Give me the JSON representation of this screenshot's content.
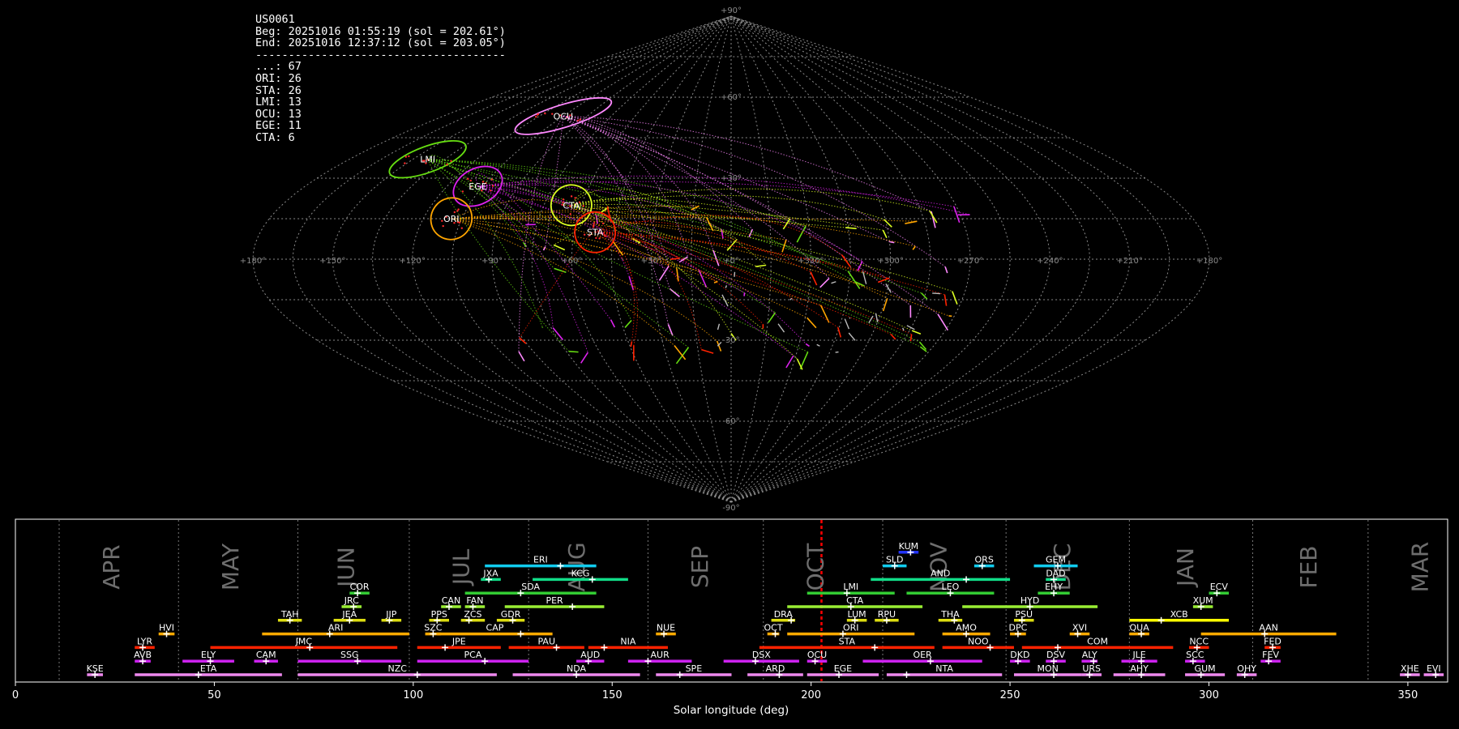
{
  "info": {
    "camera": "US0061",
    "beg": "Beg: 20251016 01:55:19 (sol = 202.61°)",
    "end": "End: 20251016 12:37:12 (sol = 203.05°)",
    "rule": "--------------------------------------",
    "counts": [
      "...: 67",
      "ORI: 26",
      "STA: 26",
      "LMI: 13",
      "OCU: 13",
      "EGE: 11",
      "CTA: 6"
    ]
  },
  "colors": {
    "ORI": "#ffa500",
    "STA": "#ff2200",
    "LMI": "#66dd11",
    "OCU": "#ff88ff",
    "EGE": "#dd22ee",
    "CTA": "#ddff22",
    "sporadic": "#bbbbbb"
  },
  "chart_data": [
    {
      "type": "scatter",
      "projection": "sinusoidal",
      "x_ticks": [
        "+180°",
        "+150°",
        "+120°",
        "+90°",
        "+60°",
        "+30°",
        "+0°",
        "+330°",
        "+300°",
        "+270°",
        "+240°",
        "+210°",
        "+180°"
      ],
      "y_ticks": [
        "+90°",
        "+60°",
        "+30°",
        "+0°",
        "-30°",
        "-60°",
        "-90°"
      ],
      "radiants": [
        {
          "name": "OCU",
          "lon": 105,
          "lat": 53,
          "color": "#ff88ff"
        },
        {
          "name": "LMI",
          "lon": 143,
          "lat": 37,
          "color": "#66dd11"
        },
        {
          "name": "EGE",
          "lon": 107,
          "lat": 27,
          "color": "#dd22ee"
        },
        {
          "name": "ORI",
          "lon": 109,
          "lat": 15,
          "color": "#ffa500"
        },
        {
          "name": "CTA",
          "lon": 64,
          "lat": 20,
          "color": "#ddff22"
        },
        {
          "name": "STA",
          "lon": 52,
          "lat": 10,
          "color": "#ff2200"
        }
      ]
    },
    {
      "type": "bar",
      "orientation": "horizontal",
      "xlabel": "Solar longitude (deg)",
      "xlim": [
        0,
        360
      ],
      "x_ticks": [
        0,
        50,
        100,
        150,
        200,
        250,
        300,
        350
      ],
      "months": [
        {
          "label": "APR",
          "sol": 24
        },
        {
          "label": "MAY",
          "sol": 54
        },
        {
          "label": "JUN",
          "sol": 83
        },
        {
          "label": "JUL",
          "sol": 112
        },
        {
          "label": "AUG",
          "sol": 141
        },
        {
          "label": "SEP",
          "sol": 172
        },
        {
          "label": "OCT",
          "sol": 201
        },
        {
          "label": "NOV",
          "sol": 232
        },
        {
          "label": "DEC",
          "sol": 263
        },
        {
          "label": "JAN",
          "sol": 294
        },
        {
          "label": "FEB",
          "sol": 325
        },
        {
          "label": "MAR",
          "sol": 353
        }
      ],
      "month_boundaries": [
        11,
        41,
        71,
        99,
        129,
        159,
        188,
        218,
        249,
        280,
        311,
        340
      ],
      "current_sol": 202.61,
      "showers": [
        {
          "code": "KUM",
          "start": 222,
          "end": 227,
          "peak": 225,
          "row": 11,
          "color": "#2233ff"
        },
        {
          "code": "ERI",
          "start": 118,
          "end": 146,
          "peak": 137,
          "row": 10,
          "color": "#11ccee"
        },
        {
          "code": "SLD",
          "start": 218,
          "end": 224,
          "peak": 221,
          "row": 10,
          "color": "#11ccee"
        },
        {
          "code": "ORS",
          "start": 241,
          "end": 246,
          "peak": 243,
          "row": 10,
          "color": "#11ccee"
        },
        {
          "code": "GEM",
          "start": 256,
          "end": 267,
          "peak": 262,
          "row": 10,
          "color": "#11ccee"
        },
        {
          "code": "JXA",
          "start": 117,
          "end": 122,
          "peak": 119,
          "row": 9,
          "color": "#11dd88"
        },
        {
          "code": "KCG",
          "start": 130,
          "end": 154,
          "peak": 145,
          "row": 9,
          "color": "#11dd88"
        },
        {
          "code": "AND",
          "start": 215,
          "end": 250,
          "peak": 239,
          "row": 9,
          "color": "#11dd88"
        },
        {
          "code": "DAD",
          "start": 259,
          "end": 264,
          "peak": 261,
          "row": 9,
          "color": "#11dd88"
        },
        {
          "code": "COR",
          "start": 84,
          "end": 89,
          "peak": 86,
          "row": 8,
          "color": "#33cc33"
        },
        {
          "code": "SDA",
          "start": 113,
          "end": 146,
          "peak": 127,
          "row": 8,
          "color": "#33cc33"
        },
        {
          "code": "LMI",
          "start": 199,
          "end": 221,
          "peak": 209,
          "row": 8,
          "color": "#33cc33"
        },
        {
          "code": "LEO",
          "start": 224,
          "end": 246,
          "peak": 235,
          "row": 8,
          "color": "#33cc33"
        },
        {
          "code": "EHY",
          "start": 257,
          "end": 265,
          "peak": 261,
          "row": 8,
          "color": "#33cc33"
        },
        {
          "code": "ECV",
          "start": 300,
          "end": 305,
          "peak": 302,
          "row": 8,
          "color": "#33cc33"
        },
        {
          "code": "JRC",
          "start": 82,
          "end": 87,
          "peak": 85,
          "row": 7,
          "color": "#99ee33"
        },
        {
          "code": "CAN",
          "start": 107,
          "end": 112,
          "peak": 109,
          "row": 7,
          "color": "#99ee33"
        },
        {
          "code": "FAN",
          "start": 113,
          "end": 118,
          "peak": 115,
          "row": 7,
          "color": "#99ee33"
        },
        {
          "code": "PER",
          "start": 123,
          "end": 148,
          "peak": 140,
          "row": 7,
          "color": "#99ee33"
        },
        {
          "code": "CTA",
          "start": 194,
          "end": 228,
          "peak": 210,
          "row": 7,
          "color": "#99ee33"
        },
        {
          "code": "HYD",
          "start": 238,
          "end": 272,
          "peak": 255,
          "row": 7,
          "color": "#99ee33"
        },
        {
          "code": "XUM",
          "start": 296,
          "end": 301,
          "peak": 298,
          "row": 7,
          "color": "#99ee33"
        },
        {
          "code": "TAH",
          "start": 66,
          "end": 72,
          "peak": 69,
          "row": 6,
          "color": "#dddd11"
        },
        {
          "code": "JEA",
          "start": 80,
          "end": 88,
          "peak": 84,
          "row": 6,
          "color": "#dddd11"
        },
        {
          "code": "JIP",
          "start": 92,
          "end": 97,
          "peak": 94,
          "row": 6,
          "color": "#dddd11"
        },
        {
          "code": "PPS",
          "start": 104,
          "end": 109,
          "peak": 106,
          "row": 6,
          "color": "#dddd11"
        },
        {
          "code": "ZCS",
          "start": 112,
          "end": 118,
          "peak": 114,
          "row": 6,
          "color": "#dddd11"
        },
        {
          "code": "GDR",
          "start": 121,
          "end": 128,
          "peak": 125,
          "row": 6,
          "color": "#dddd11"
        },
        {
          "code": "DRA",
          "start": 190,
          "end": 196,
          "peak": 195,
          "row": 6,
          "color": "#dddd11"
        },
        {
          "code": "LUM",
          "start": 209,
          "end": 214,
          "peak": 211,
          "row": 6,
          "color": "#dddd11"
        },
        {
          "code": "RPU",
          "start": 216,
          "end": 222,
          "peak": 219,
          "row": 6,
          "color": "#dddd11"
        },
        {
          "code": "THA",
          "start": 232,
          "end": 238,
          "peak": 236,
          "row": 6,
          "color": "#dddd11"
        },
        {
          "code": "PSU",
          "start": 251,
          "end": 256,
          "peak": 253,
          "row": 6,
          "color": "#dddd11"
        },
        {
          "code": "XCB",
          "start": 280,
          "end": 305,
          "peak": 288,
          "row": 6,
          "color": "#ffff00"
        },
        {
          "code": "HVI",
          "start": 36,
          "end": 40,
          "peak": 38,
          "row": 5,
          "color": "#ffaa00"
        },
        {
          "code": "ARI",
          "start": 62,
          "end": 99,
          "peak": 79,
          "row": 5,
          "color": "#ffaa00"
        },
        {
          "code": "SZC",
          "start": 103,
          "end": 107,
          "peak": 105,
          "row": 5,
          "color": "#ffaa00"
        },
        {
          "code": "CAP",
          "start": 106,
          "end": 135,
          "peak": 127,
          "row": 5,
          "color": "#ffaa00"
        },
        {
          "code": "NUE",
          "start": 161,
          "end": 166,
          "peak": 163,
          "row": 5,
          "color": "#ffaa00"
        },
        {
          "code": "OCT",
          "start": 189,
          "end": 192,
          "peak": 191,
          "row": 5,
          "color": "#ffaa00"
        },
        {
          "code": "ORI",
          "start": 194,
          "end": 226,
          "peak": 208,
          "row": 5,
          "color": "#ffaa00"
        },
        {
          "code": "AMO",
          "start": 233,
          "end": 245,
          "peak": 239,
          "row": 5,
          "color": "#ffaa00"
        },
        {
          "code": "DPC",
          "start": 250,
          "end": 254,
          "peak": 252,
          "row": 5,
          "color": "#ffaa00"
        },
        {
          "code": "XVI",
          "start": 265,
          "end": 270,
          "peak": 267,
          "row": 5,
          "color": "#ffaa00"
        },
        {
          "code": "QUA",
          "start": 280,
          "end": 285,
          "peak": 283,
          "row": 5,
          "color": "#ffaa00"
        },
        {
          "code": "AAN",
          "start": 298,
          "end": 332,
          "peak": 314,
          "row": 5,
          "color": "#ffaa00"
        },
        {
          "code": "LYR",
          "start": 30,
          "end": 35,
          "peak": 32,
          "row": 4,
          "color": "#ff2200"
        },
        {
          "code": "JMC",
          "start": 49,
          "end": 96,
          "peak": 74,
          "row": 4,
          "color": "#ff2200"
        },
        {
          "code": "JPE",
          "start": 101,
          "end": 122,
          "peak": 108,
          "row": 4,
          "color": "#ff2200"
        },
        {
          "code": "PAU",
          "start": 124,
          "end": 143,
          "peak": 136,
          "row": 4,
          "color": "#ff2200"
        },
        {
          "code": "NIA",
          "start": 144,
          "end": 164,
          "peak": 148,
          "row": 4,
          "color": "#ff2200"
        },
        {
          "code": "STA",
          "start": 187,
          "end": 231,
          "peak": 216,
          "row": 4,
          "color": "#ff2200"
        },
        {
          "code": "NOO",
          "start": 233,
          "end": 251,
          "peak": 245,
          "row": 4,
          "color": "#ff2200"
        },
        {
          "code": "COM",
          "start": 253,
          "end": 291,
          "peak": 262,
          "row": 4,
          "color": "#ff2200"
        },
        {
          "code": "NCC",
          "start": 295,
          "end": 300,
          "peak": 297,
          "row": 4,
          "color": "#ff2200"
        },
        {
          "code": "FED",
          "start": 314,
          "end": 318,
          "peak": 316,
          "row": 4,
          "color": "#ff2200"
        },
        {
          "code": "AVB",
          "start": 30,
          "end": 34,
          "peak": 32,
          "row": 3,
          "color": "#cc22ee"
        },
        {
          "code": "ELY",
          "start": 42,
          "end": 55,
          "peak": 49,
          "row": 3,
          "color": "#cc22ee"
        },
        {
          "code": "CAM",
          "start": 60,
          "end": 66,
          "peak": 63,
          "row": 3,
          "color": "#cc22ee"
        },
        {
          "code": "SSG",
          "start": 71,
          "end": 97,
          "peak": 86,
          "row": 3,
          "color": "#cc22ee"
        },
        {
          "code": "PCA",
          "start": 101,
          "end": 129,
          "peak": 118,
          "row": 3,
          "color": "#cc22ee"
        },
        {
          "code": "AUD",
          "start": 141,
          "end": 148,
          "peak": 144,
          "row": 3,
          "color": "#cc22ee"
        },
        {
          "code": "AUR",
          "start": 154,
          "end": 170,
          "peak": 159,
          "row": 3,
          "color": "#cc22ee"
        },
        {
          "code": "DSX",
          "start": 178,
          "end": 197,
          "peak": 186,
          "row": 3,
          "color": "#cc22ee"
        },
        {
          "code": "OCU",
          "start": 199,
          "end": 204,
          "peak": 201,
          "row": 3,
          "color": "#cc22ee"
        },
        {
          "code": "OER",
          "start": 213,
          "end": 243,
          "peak": 230,
          "row": 3,
          "color": "#cc22ee"
        },
        {
          "code": "DKD",
          "start": 250,
          "end": 255,
          "peak": 252,
          "row": 3,
          "color": "#cc22ee"
        },
        {
          "code": "DSV",
          "start": 259,
          "end": 264,
          "peak": 261,
          "row": 3,
          "color": "#cc22ee"
        },
        {
          "code": "ALY",
          "start": 268,
          "end": 272,
          "peak": 271,
          "row": 3,
          "color": "#cc22ee"
        },
        {
          "code": "JLE",
          "start": 278,
          "end": 287,
          "peak": 283,
          "row": 3,
          "color": "#cc22ee"
        },
        {
          "code": "SCC",
          "start": 294,
          "end": 299,
          "peak": 296,
          "row": 3,
          "color": "#cc22ee"
        },
        {
          "code": "FEV",
          "start": 313,
          "end": 318,
          "peak": 315,
          "row": 3,
          "color": "#cc22ee"
        },
        {
          "code": "KSE",
          "start": 18,
          "end": 22,
          "peak": 20,
          "row": 2,
          "color": "#ee88ee"
        },
        {
          "code": "ETA",
          "start": 30,
          "end": 67,
          "peak": 46,
          "row": 2,
          "color": "#ee88ee"
        },
        {
          "code": "NZC",
          "start": 71,
          "end": 121,
          "peak": 101,
          "row": 2,
          "color": "#ee88ee"
        },
        {
          "code": "NDA",
          "start": 125,
          "end": 157,
          "peak": 141,
          "row": 2,
          "color": "#ee88ee"
        },
        {
          "code": "SPE",
          "start": 161,
          "end": 180,
          "peak": 167,
          "row": 2,
          "color": "#ee88ee"
        },
        {
          "code": "ARD",
          "start": 184,
          "end": 198,
          "peak": 192,
          "row": 2,
          "color": "#ee88ee"
        },
        {
          "code": "EGE",
          "start": 199,
          "end": 217,
          "peak": 207,
          "row": 2,
          "color": "#ee88ee"
        },
        {
          "code": "NTA",
          "start": 219,
          "end": 248,
          "peak": 224,
          "row": 2,
          "color": "#ee88ee"
        },
        {
          "code": "MON",
          "start": 251,
          "end": 268,
          "peak": 261,
          "row": 2,
          "color": "#ee88ee"
        },
        {
          "code": "URS",
          "start": 268,
          "end": 273,
          "peak": 270,
          "row": 2,
          "color": "#ee88ee"
        },
        {
          "code": "AHY",
          "start": 276,
          "end": 289,
          "peak": 283,
          "row": 2,
          "color": "#ee88ee"
        },
        {
          "code": "GUM",
          "start": 294,
          "end": 304,
          "peak": 298,
          "row": 2,
          "color": "#ee88ee"
        },
        {
          "code": "OHY",
          "start": 307,
          "end": 312,
          "peak": 309,
          "row": 2,
          "color": "#ee88ee"
        },
        {
          "code": "XHE",
          "start": 348,
          "end": 353,
          "peak": 350,
          "row": 2,
          "color": "#ee88ee"
        },
        {
          "code": "EVI",
          "start": 354,
          "end": 359,
          "peak": 357,
          "row": 2,
          "color": "#ee88ee"
        }
      ]
    }
  ]
}
